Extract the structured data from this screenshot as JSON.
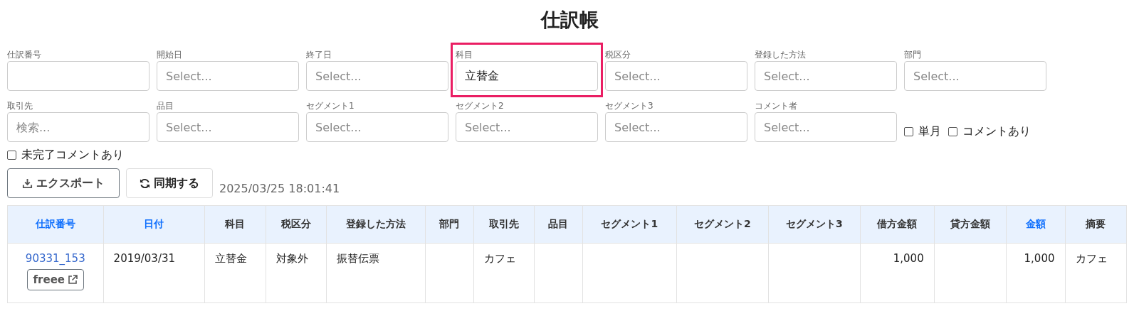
{
  "title": "仕訳帳",
  "filters": [
    {
      "label": "仕訳番号",
      "highlighted": false
    },
    {
      "label": "開始日",
      "placeholder": "Select...",
      "highlighted": false
    },
    {
      "label": "終了日",
      "placeholder": "Select...",
      "highlighted": false
    },
    {
      "label": "科目",
      "value": "立替金",
      "highlighted": true
    },
    {
      "label": "税区分",
      "placeholder": "Select...",
      "highlighted": false
    },
    {
      "label": "登録した方法",
      "placeholder": "Select...",
      "highlighted": false
    },
    {
      "label": "部門",
      "placeholder": "Select...",
      "highlighted": false
    },
    {
      "label": "取引先",
      "placeholder": "検索...",
      "highlighted": false
    },
    {
      "label": "品目",
      "placeholder": "Select...",
      "highlighted": false
    },
    {
      "label": "セグメント1",
      "placeholder": "Select...",
      "highlighted": false
    },
    {
      "label": "セグメント2",
      "placeholder": "Select...",
      "highlighted": false
    },
    {
      "label": "セグメント3",
      "placeholder": "Select...",
      "highlighted": false
    },
    {
      "label": "コメント者",
      "placeholder": "Select...",
      "highlighted": false
    }
  ],
  "inline_options": [
    {
      "label": "単月",
      "checked": false
    },
    {
      "label": "コメントあり",
      "checked": false
    }
  ],
  "options": [
    {
      "label": "未完了コメントあり",
      "checked": false
    }
  ],
  "buttons": [
    {
      "label": "エクスポート",
      "kind": "export"
    },
    {
      "label": "同期する",
      "kind": "sync"
    }
  ],
  "synced_at": "2025/03/25 18:01:41",
  "table": {
    "columns": [
      {
        "label": "仕訳番号",
        "sortable": true,
        "kind": "text"
      },
      {
        "label": "日付",
        "sortable": true,
        "kind": "text"
      },
      {
        "label": "科目",
        "sortable": false,
        "kind": "text"
      },
      {
        "label": "税区分",
        "sortable": false,
        "kind": "text"
      },
      {
        "label": "登録した方法",
        "sortable": false,
        "kind": "text"
      },
      {
        "label": "部門",
        "sortable": false,
        "kind": "text"
      },
      {
        "label": "取引先",
        "sortable": false,
        "kind": "text"
      },
      {
        "label": "品目",
        "sortable": false,
        "kind": "text"
      },
      {
        "label": "セグメント1",
        "sortable": false,
        "kind": "text"
      },
      {
        "label": "セグメント2",
        "sortable": false,
        "kind": "text"
      },
      {
        "label": "セグメント3",
        "sortable": false,
        "kind": "text"
      },
      {
        "label": "借方金額",
        "sortable": false,
        "kind": "amount"
      },
      {
        "label": "貸方金額",
        "sortable": false,
        "kind": "amount"
      },
      {
        "label": "金額",
        "sortable": true,
        "kind": "amount"
      },
      {
        "label": "摘要",
        "sortable": false,
        "kind": "text"
      }
    ],
    "rows": [
      {
        "id": "90331_153",
        "link_button": "freee",
        "cells": [
          null,
          "2019/03/31",
          "立替金",
          "対象外",
          "振替伝票",
          null,
          "カフェ",
          null,
          null,
          null,
          null,
          "1,000",
          null,
          "1,000",
          "カフェ"
        ]
      }
    ]
  }
}
